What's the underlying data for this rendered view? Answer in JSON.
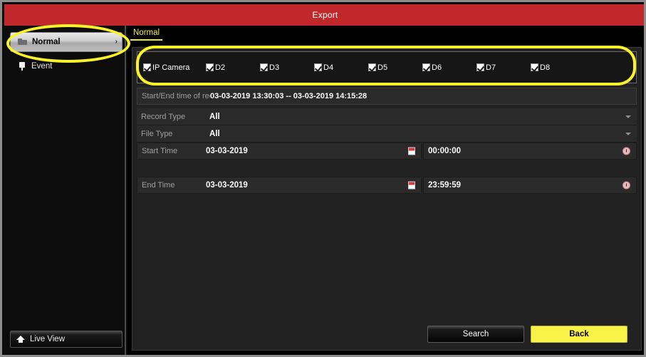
{
  "window": {
    "title": "Export"
  },
  "sidebar": {
    "items": [
      {
        "label": "Normal",
        "icon": "folder-icon",
        "selected": true,
        "arrow": "›"
      },
      {
        "label": "Event",
        "icon": "event-icon",
        "selected": false
      }
    ],
    "live_view": {
      "label": "Live View",
      "icon": "home-icon"
    }
  },
  "main": {
    "tabs": [
      {
        "label": "Normal",
        "active": true
      }
    ],
    "cameras": {
      "items": [
        {
          "label": "IP Camera",
          "checked": true
        },
        {
          "label": "D2",
          "checked": true
        },
        {
          "label": "D3",
          "checked": true
        },
        {
          "label": "D4",
          "checked": true
        },
        {
          "label": "D5",
          "checked": true
        },
        {
          "label": "D6",
          "checked": true
        },
        {
          "label": "D7",
          "checked": true
        },
        {
          "label": "D8",
          "checked": true
        }
      ]
    },
    "record_info": {
      "label": "Start/End time of rec",
      "value": "03-03-2019 13:30:03 -- 03-03-2019 14:15:28"
    },
    "fields": {
      "record_type": {
        "label": "Record Type",
        "value": "All"
      },
      "file_type": {
        "label": "File Type",
        "value": "All"
      },
      "start_time": {
        "label": "Start Time",
        "date": "03-03-2019",
        "time": "00:00:00",
        "date_icon": "calendar-icon",
        "time_icon": "clock-icon"
      },
      "end_time": {
        "label": "End Time",
        "date": "03-03-2019",
        "time": "23:59:59",
        "date_icon": "calendar-icon",
        "time_icon": "clock-icon"
      }
    },
    "buttons": {
      "search": "Search",
      "back": "Back"
    }
  },
  "colors": {
    "titlebar": "#c1282b",
    "accent_yellow": "#f9f348",
    "annotation": "#fbf32a",
    "panel": "#222222",
    "row": "#2a2a2a"
  }
}
